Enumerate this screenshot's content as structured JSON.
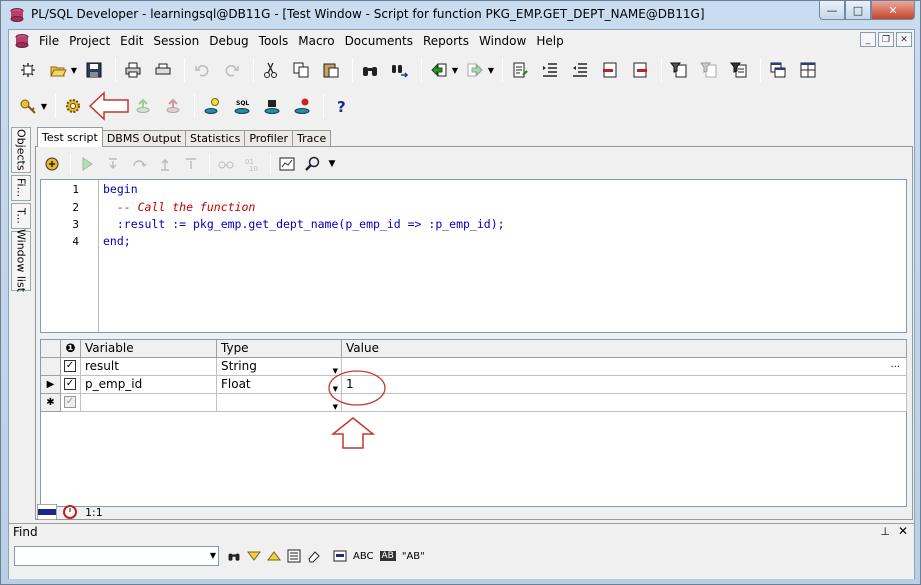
{
  "window": {
    "title": "PL/SQL Developer - learningsql@DB11G - [Test Window - Script for function PKG_EMP.GET_DEPT_NAME@DB11G]",
    "caption": {
      "minimize": "—",
      "maximize": "□",
      "close": "✕"
    }
  },
  "menu": [
    "File",
    "Project",
    "Edit",
    "Session",
    "Debug",
    "Tools",
    "Macro",
    "Documents",
    "Reports",
    "Window",
    "Help"
  ],
  "mdi_buttons": {
    "minimize": "_",
    "restore": "❐",
    "close": "✕"
  },
  "side_tabs": [
    "Objects",
    "Fi...",
    "T...",
    "Window list"
  ],
  "tabs": [
    {
      "label": "Test script",
      "active": true
    },
    {
      "label": "DBMS Output",
      "active": false
    },
    {
      "label": "Statistics",
      "active": false
    },
    {
      "label": "Profiler",
      "active": false
    },
    {
      "label": "Trace",
      "active": false
    }
  ],
  "editor": {
    "line_numbers": [
      "1",
      "2",
      "3",
      "4"
    ],
    "lines": [
      "begin",
      "  -- Call the function",
      "  :result := pkg_emp.get_dept_name(p_emp_id => :p_emp_id);",
      "end;"
    ]
  },
  "variables_grid": {
    "headers": {
      "variable": "Variable",
      "type": "Type",
      "value": "Value"
    },
    "rows": [
      {
        "indicator": "",
        "checked": true,
        "variable": "result",
        "type": "String",
        "value": "",
        "value_button": "..."
      },
      {
        "indicator": "▶",
        "checked": true,
        "variable": "p_emp_id",
        "type": "Float",
        "value": "1",
        "value_button": ""
      },
      {
        "indicator": "✱",
        "checked": true,
        "variable": "",
        "type": "",
        "value": "",
        "value_button": ""
      }
    ]
  },
  "status": {
    "position": "1:1"
  },
  "find": {
    "title": "Find",
    "pin": "⊥",
    "close": "✕",
    "input_value": "",
    "abc_label": "ABC",
    "ab_label": "AB",
    "quoted_label": "\"AB\""
  },
  "colors": {
    "keyword": "#0000c0",
    "comment": "#c00000",
    "annotation": "#c0392b"
  }
}
